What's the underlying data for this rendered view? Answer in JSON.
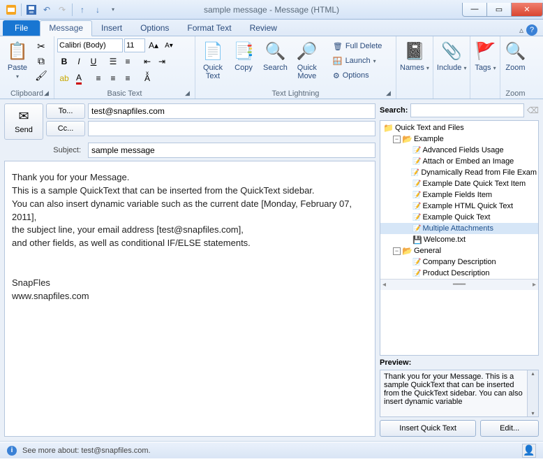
{
  "window": {
    "title": "sample message  -  Message (HTML)"
  },
  "tabs": {
    "file": "File",
    "items": [
      "Message",
      "Insert",
      "Options",
      "Format Text",
      "Review"
    ],
    "active": 0
  },
  "ribbon": {
    "clipboard": {
      "label": "Clipboard",
      "paste": "Paste"
    },
    "basictext": {
      "label": "Basic Text",
      "font": "Calibri (Body)",
      "size": "11"
    },
    "textlightning": {
      "label": "Text Lightning",
      "quicktext": "Quick\nText",
      "copy": "Copy",
      "search": "Search",
      "quickmove": "Quick\nMove",
      "fulldelete": "Full Delete",
      "launch": "Launch",
      "options": "Options"
    },
    "names": {
      "label": "Names",
      "btn": "Names"
    },
    "include": {
      "label": "Include",
      "btn": "Include"
    },
    "tags": {
      "label": "Tags",
      "btn": "Tags"
    },
    "zoom": {
      "label": "Zoom",
      "btn": "Zoom"
    }
  },
  "compose": {
    "send": "Send",
    "to_label": "To...",
    "to_value": "test@snapfiles.com",
    "cc_label": "Cc...",
    "cc_value": "",
    "subject_label": "Subject:",
    "subject_value": "sample message",
    "body_lines": [
      "Thank you for your Message.",
      "This is a sample QuickText that can be inserted from the QuickText sidebar.",
      "You can also insert dynamic variable such as the current date [Monday, February 07, 2011],",
      "the subject line, your email address [test@snapfiles.com],",
      "and other  fields, as well as conditional IF/ELSE statements.",
      "",
      "",
      "SnapFles",
      "www.snapfiles.com"
    ]
  },
  "sidebar": {
    "search_label": "Search:",
    "root": "Quick Text and Files",
    "folders": [
      {
        "name": "Example",
        "items": [
          {
            "label": "Advanced Fields Usage",
            "type": "qt"
          },
          {
            "label": "Attach or Embed an Image",
            "type": "qt"
          },
          {
            "label": "Dynamically Read from File Exam",
            "type": "qt"
          },
          {
            "label": "Example Date Quick Text Item",
            "type": "qt"
          },
          {
            "label": "Example Fields Item",
            "type": "qt"
          },
          {
            "label": "Example HTML Quick Text",
            "type": "qt"
          },
          {
            "label": "Example Quick Text",
            "type": "qt"
          },
          {
            "label": "Multiple Attachments",
            "type": "qt",
            "selected": true
          },
          {
            "label": "Welcome.txt",
            "type": "file"
          }
        ]
      },
      {
        "name": "General",
        "items": [
          {
            "label": "Company Description",
            "type": "qt"
          },
          {
            "label": "Product Description",
            "type": "qt"
          }
        ]
      }
    ],
    "preview_label": "Preview:",
    "preview_text": "Thank you for your Message.\nThis is a sample QuickText that can be inserted from the QuickText sidebar. You can also insert dynamic variable",
    "insert_btn": "Insert Quick Text",
    "edit_btn": "Edit..."
  },
  "statusbar": {
    "text": "See more about: test@snapfiles.com."
  }
}
